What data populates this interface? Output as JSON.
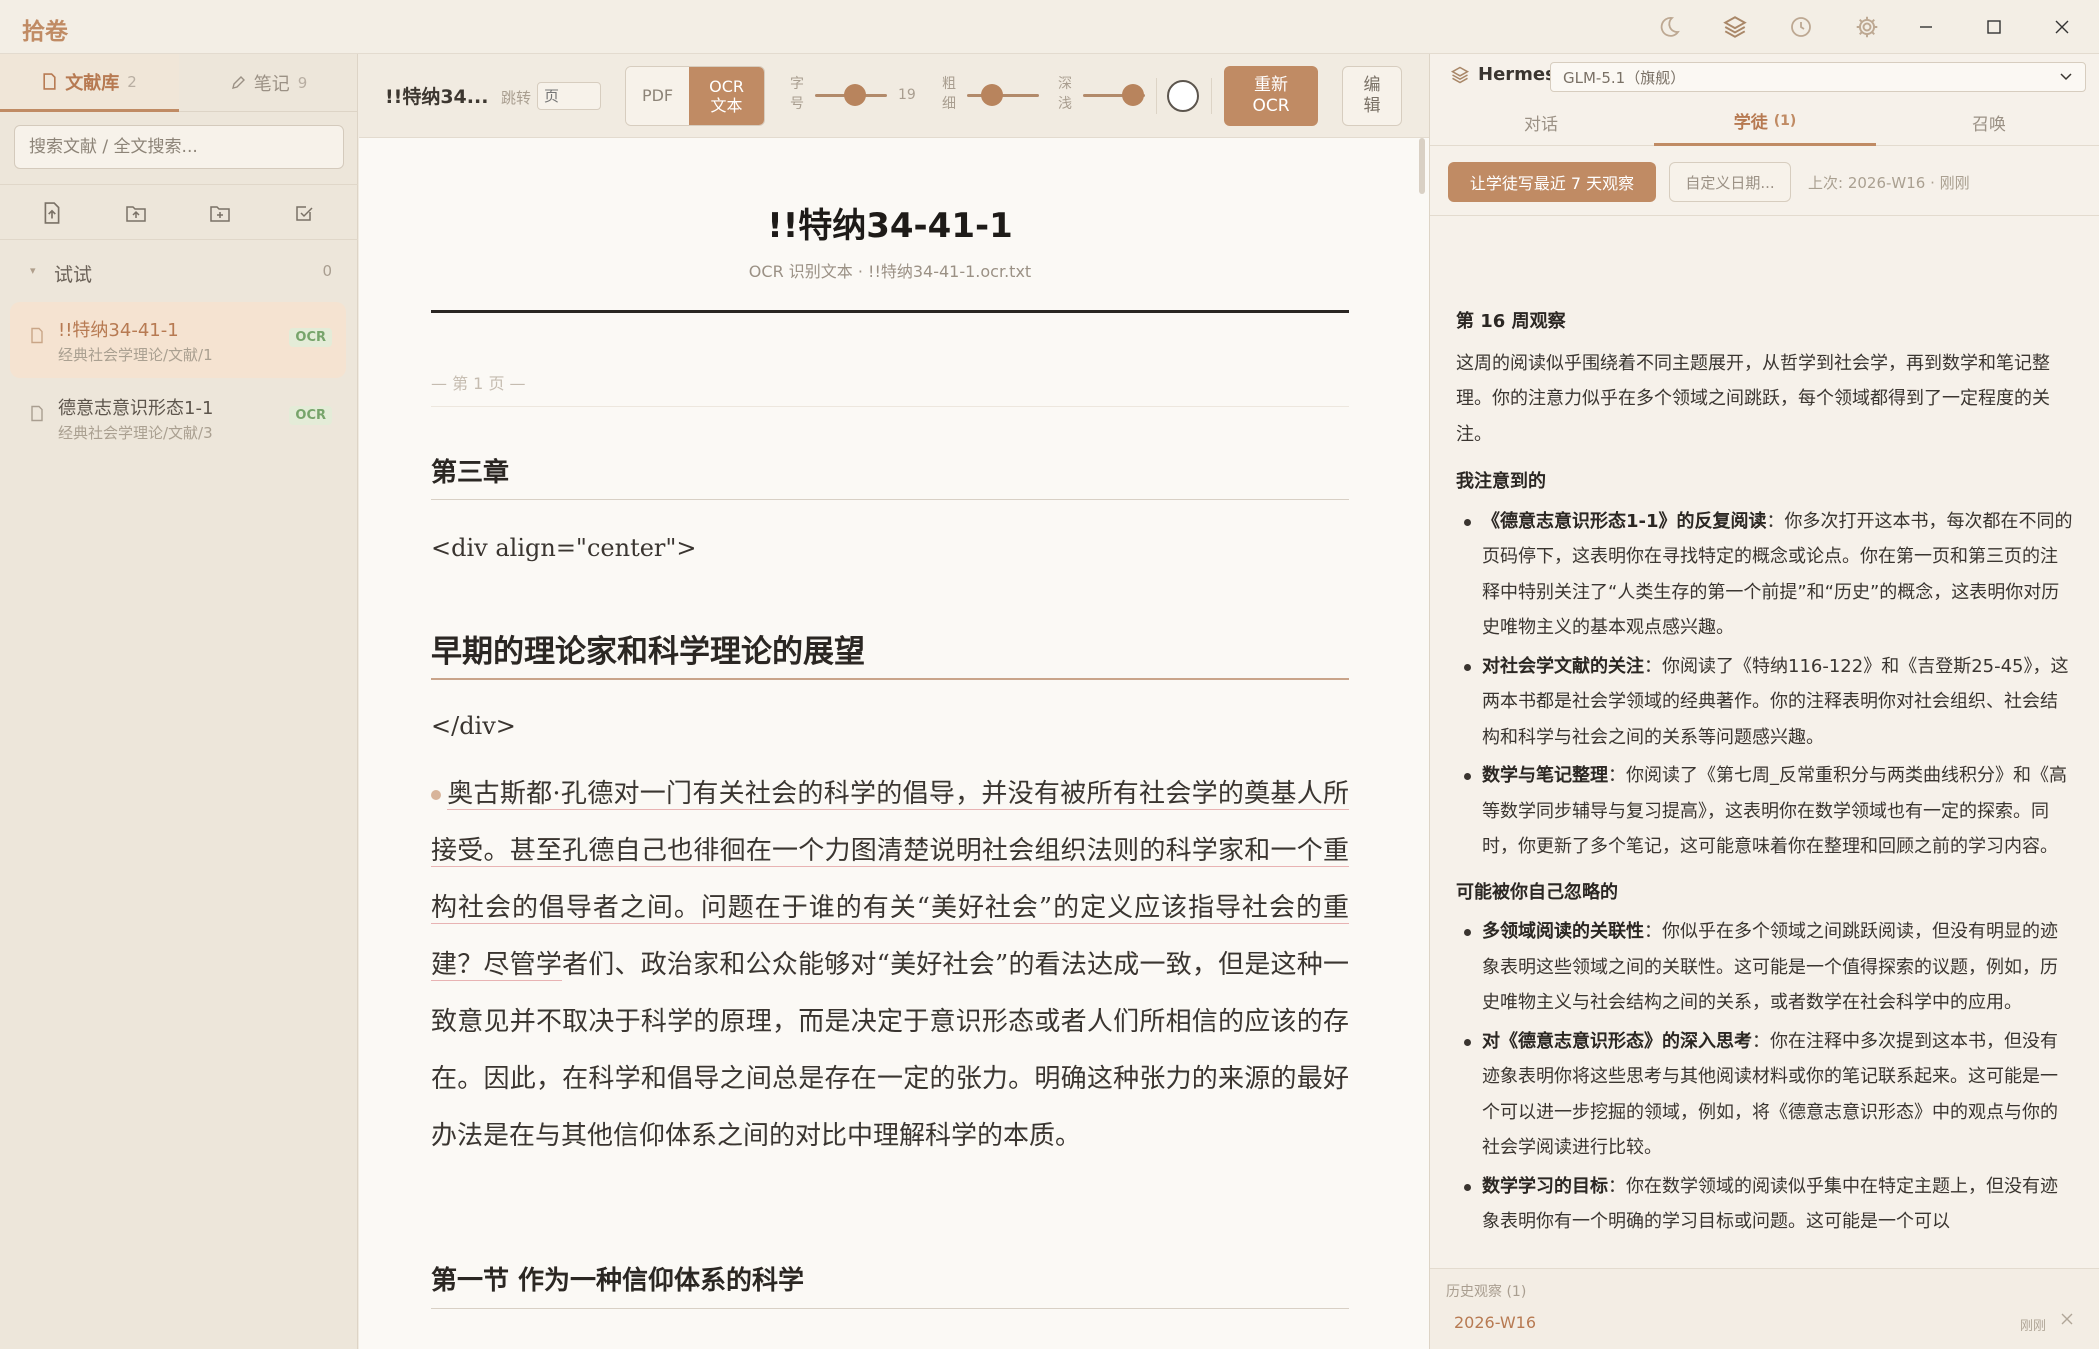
{
  "app": {
    "name": "拾卷"
  },
  "sidebar": {
    "tabs": [
      {
        "label": "文献库",
        "count": "2"
      },
      {
        "label": "笔记",
        "count": "9"
      }
    ],
    "search_placeholder": "搜索文献 / 全文搜索...",
    "tools": [
      "import-file-icon",
      "upload-folder-icon",
      "new-folder-icon",
      "check-square-icon"
    ],
    "folder": {
      "name": "试试",
      "count": "0"
    },
    "documents": [
      {
        "title": "!!特纳34-41-1",
        "path": "经典社会学理论/文献/1",
        "badge": "OCR"
      },
      {
        "title": "德意志意识形态1-1",
        "path": "经典社会学理论/文献/3",
        "badge": "OCR"
      }
    ]
  },
  "toolbar": {
    "doc_title": "!!特纳34...",
    "jump_label": "跳转",
    "jump_placeholder": "页",
    "view_pdf": "PDF",
    "view_ocr": "OCR\n文本",
    "font_size_label": "字号",
    "font_size_value": "19",
    "weight_label": "粗细",
    "depth_label": "深浅",
    "reocr_label": "重新\nOCR",
    "edit_label": "编\n辑"
  },
  "sliders": {
    "font_size": 0.55,
    "weight": 0.35,
    "depth": 0.8
  },
  "document": {
    "title": "!!特纳34-41-1",
    "subtitle": "OCR 识别文本 · !!特纳34-41-1.ocr.txt",
    "page_marker": "— 第 1 页 —",
    "chapter": "第三章",
    "code_open": "<div align=\"center\">",
    "heading": "早期的理论家和科学理论的展望",
    "code_close": "</div>",
    "para_hl": "奥古斯都·孔德对一门有关社会的科学的倡导，并没有被所有社会学的奠基人所接受。甚至孔德自己也徘徊在一个力图清楚说明社会组织法则的科学家和一个重构社会的倡导者之间。问题在于谁的有关“美好社会”的定义应该指导社会的重建？尽管学",
    "para_rest": "者们、政治家和公众能够对“美好社会”的看法达成一致，但是这种一致意见并不取决于科学的原理，而是决定于意识形态或者人们所相信的应该的存在。因此，在科学和倡导之间总是存在一定的张力。明确这种张力的来源的最好办法是在与其他信仰体系之间的对比中理解科学的本质。",
    "section": "第一节 作为一种信仰体系的科学"
  },
  "right_panel": {
    "brand": "Hermes",
    "model": "GLM-5.1（旗舰）",
    "tabs": [
      {
        "label": "对话",
        "count": ""
      },
      {
        "label": "学徒",
        "count": "(1)"
      },
      {
        "label": "召唤",
        "count": ""
      }
    ],
    "primary_action": "让学徒写最近 7 天观察",
    "custom_date": "自定义日期...",
    "last_run": "上次: 2026-W16 · 刚刚",
    "report": {
      "title": "第 16 周观察",
      "intro": "这周的阅读似乎围绕着不同主题展开，从哲学到社会学，再到数学和笔记整理。你的注意力似乎在多个领域之间跳跃，每个领域都得到了一定程度的关注。",
      "noticed_heading": "我注意到的",
      "noticed": [
        {
          "bold": "《德意志意识形态1-1》的反复阅读",
          "text": "：你多次打开这本书，每次都在不同的页码停下，这表明你在寻找特定的概念或论点。你在第一页和第三页的注释中特别关注了“人类生存的第一个前提”和“历史”的概念，这表明你对历史唯物主义的基本观点感兴趣。"
        },
        {
          "bold": "对社会学文献的关注",
          "text": "：你阅读了《特纳116-122》和《吉登斯25-45》，这两本书都是社会学领域的经典著作。你的注释表明你对社会组织、社会结构和科学与社会之间的关系等问题感兴趣。"
        },
        {
          "bold": "数学与笔记整理",
          "text": "：你阅读了《第七周_反常重积分与两类曲线积分》和《高等数学同步辅导与复习提高》，这表明你在数学领域也有一定的探索。同时，你更新了多个笔记，这可能意味着你在整理和回顾之前的学习内容。"
        }
      ],
      "overlooked_heading": "可能被你自己忽略的",
      "overlooked": [
        {
          "bold": "多领域阅读的关联性",
          "text": "：你似乎在多个领域之间跳跃阅读，但没有明显的迹象表明这些领域之间的关联性。这可能是一个值得探索的议题，例如，历史唯物主义与社会结构之间的关系，或者数学在社会科学中的应用。"
        },
        {
          "bold": "对《德意志意识形态》的深入思考",
          "text": "：你在注释中多次提到这本书，但没有迹象表明你将这些思考与其他阅读材料或你的笔记联系起来。这可能是一个可以进一步挖掘的领域，例如，将《德意志意识形态》中的观点与你的社会学阅读进行比较。"
        },
        {
          "bold": "数学学习的目标",
          "text": "：你在数学领域的阅读似乎集中在特定主题上，但没有迹象表明你有一个明确的学习目标或问题。这可能是一个可以"
        }
      ]
    },
    "history_label": "历史观察 (1)",
    "history_item": "2026-W16",
    "history_time": "刚刚"
  }
}
